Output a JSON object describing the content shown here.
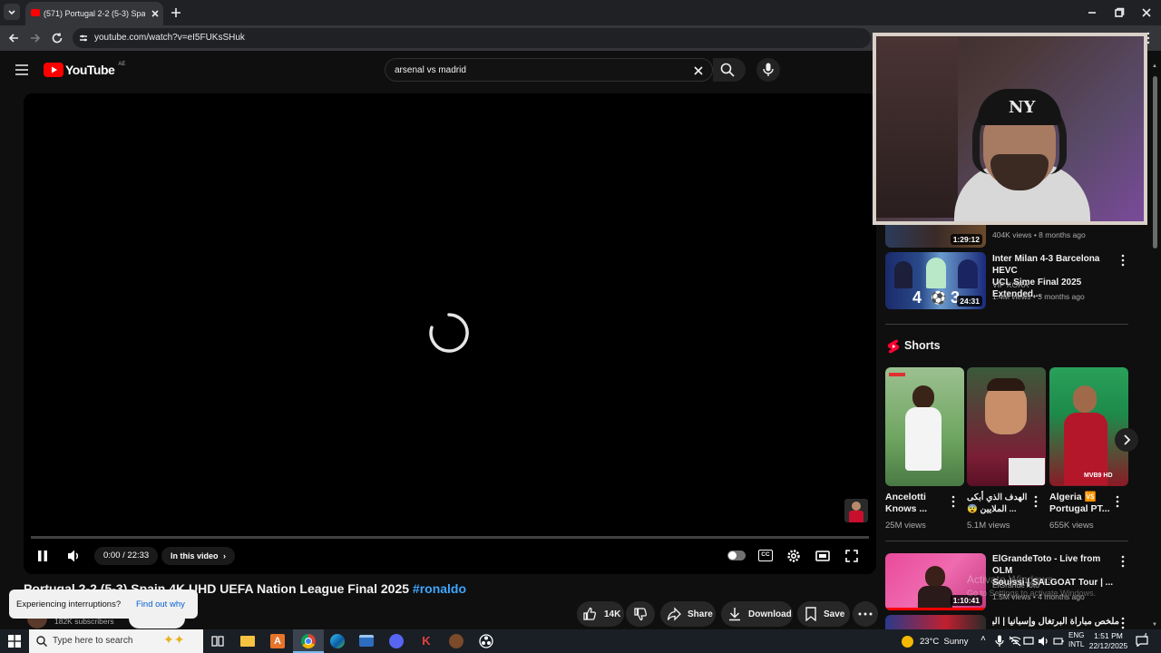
{
  "browser": {
    "tab_title": "(571) Portugal 2-2 (5-3) Spain 4...",
    "url": "youtube.com/watch?v=eI5FUKsSHuk"
  },
  "header": {
    "logo_text": "YouTube",
    "country_code": "AE",
    "search_value": "arsenal vs madrid"
  },
  "player": {
    "time": "0:00 / 22:33",
    "in_this_video": "In this video"
  },
  "video": {
    "title_main": "Portugal 2-2 (5-3) Spain 4K UHD UEFA Nation League Final 2025",
    "title_tag": "#ronaldo",
    "subscribers": "182K subscribers",
    "like_count": "14K",
    "share_label": "Share",
    "download_label": "Download",
    "save_label": "Save"
  },
  "toast": {
    "message": "Experiencing interruptions?",
    "action": "Find out why"
  },
  "sidebar": {
    "top_item": {
      "duration": "1:29:12",
      "meta": "404K views • 8 months ago"
    },
    "video_1": {
      "title_line1": "Inter Milan 4-3 Barcelona HEVC",
      "title_line2": "UCL Sime Final 2025 Extended...",
      "channel": "VIP KORA",
      "meta": "1.4M views • 3 months ago",
      "duration": "24:31",
      "score_left": "4",
      "score_right": "3"
    },
    "shorts_heading": "Shorts",
    "shorts": [
      {
        "title_line1": "Ancelotti",
        "title_line2": "Knows ...",
        "views": "25M views",
        "color": "#6ea560"
      },
      {
        "title_line1": "الهدف الذي أبكى",
        "title_line2": "😨 الملايين ...",
        "views": "5.1M views",
        "color": "#7a1f35"
      },
      {
        "title_line1": "Algeria 🆚",
        "title_line2": "Portugal PT...",
        "views": "655K views",
        "color": "#1d8a4a"
      }
    ],
    "short_3_badge": "MVB9 HD",
    "video_2": {
      "title_line1": "ElGrandeToto - Live from OLM",
      "title_line2": "Souissi | SALGOAT Tour | ...",
      "channel": "ElGrandeToto",
      "meta": "1.5M views • 4 months ago",
      "duration": "1:10:41"
    },
    "video_3": {
      "title_line1": "ملخص مباراة البرتغال وإسبانيا | البرتغال"
    },
    "watermark_line1": "Activate Windows",
    "watermark_line2": "Go to Settings to activate Windows."
  },
  "taskbar": {
    "search_placeholder": "Type here to search",
    "weather": "23°C  Sunny",
    "lang_line1": "ENG",
    "lang_line2": "INTL",
    "time": "1:51 PM",
    "date": "22/12/2025",
    "notif_count": "4"
  },
  "colors": {
    "youtube_red": "#ff0000",
    "link_blue": "#3ea6ff",
    "taskbar_bg": "#1a1f26",
    "page_bg": "#0f0f0f"
  }
}
